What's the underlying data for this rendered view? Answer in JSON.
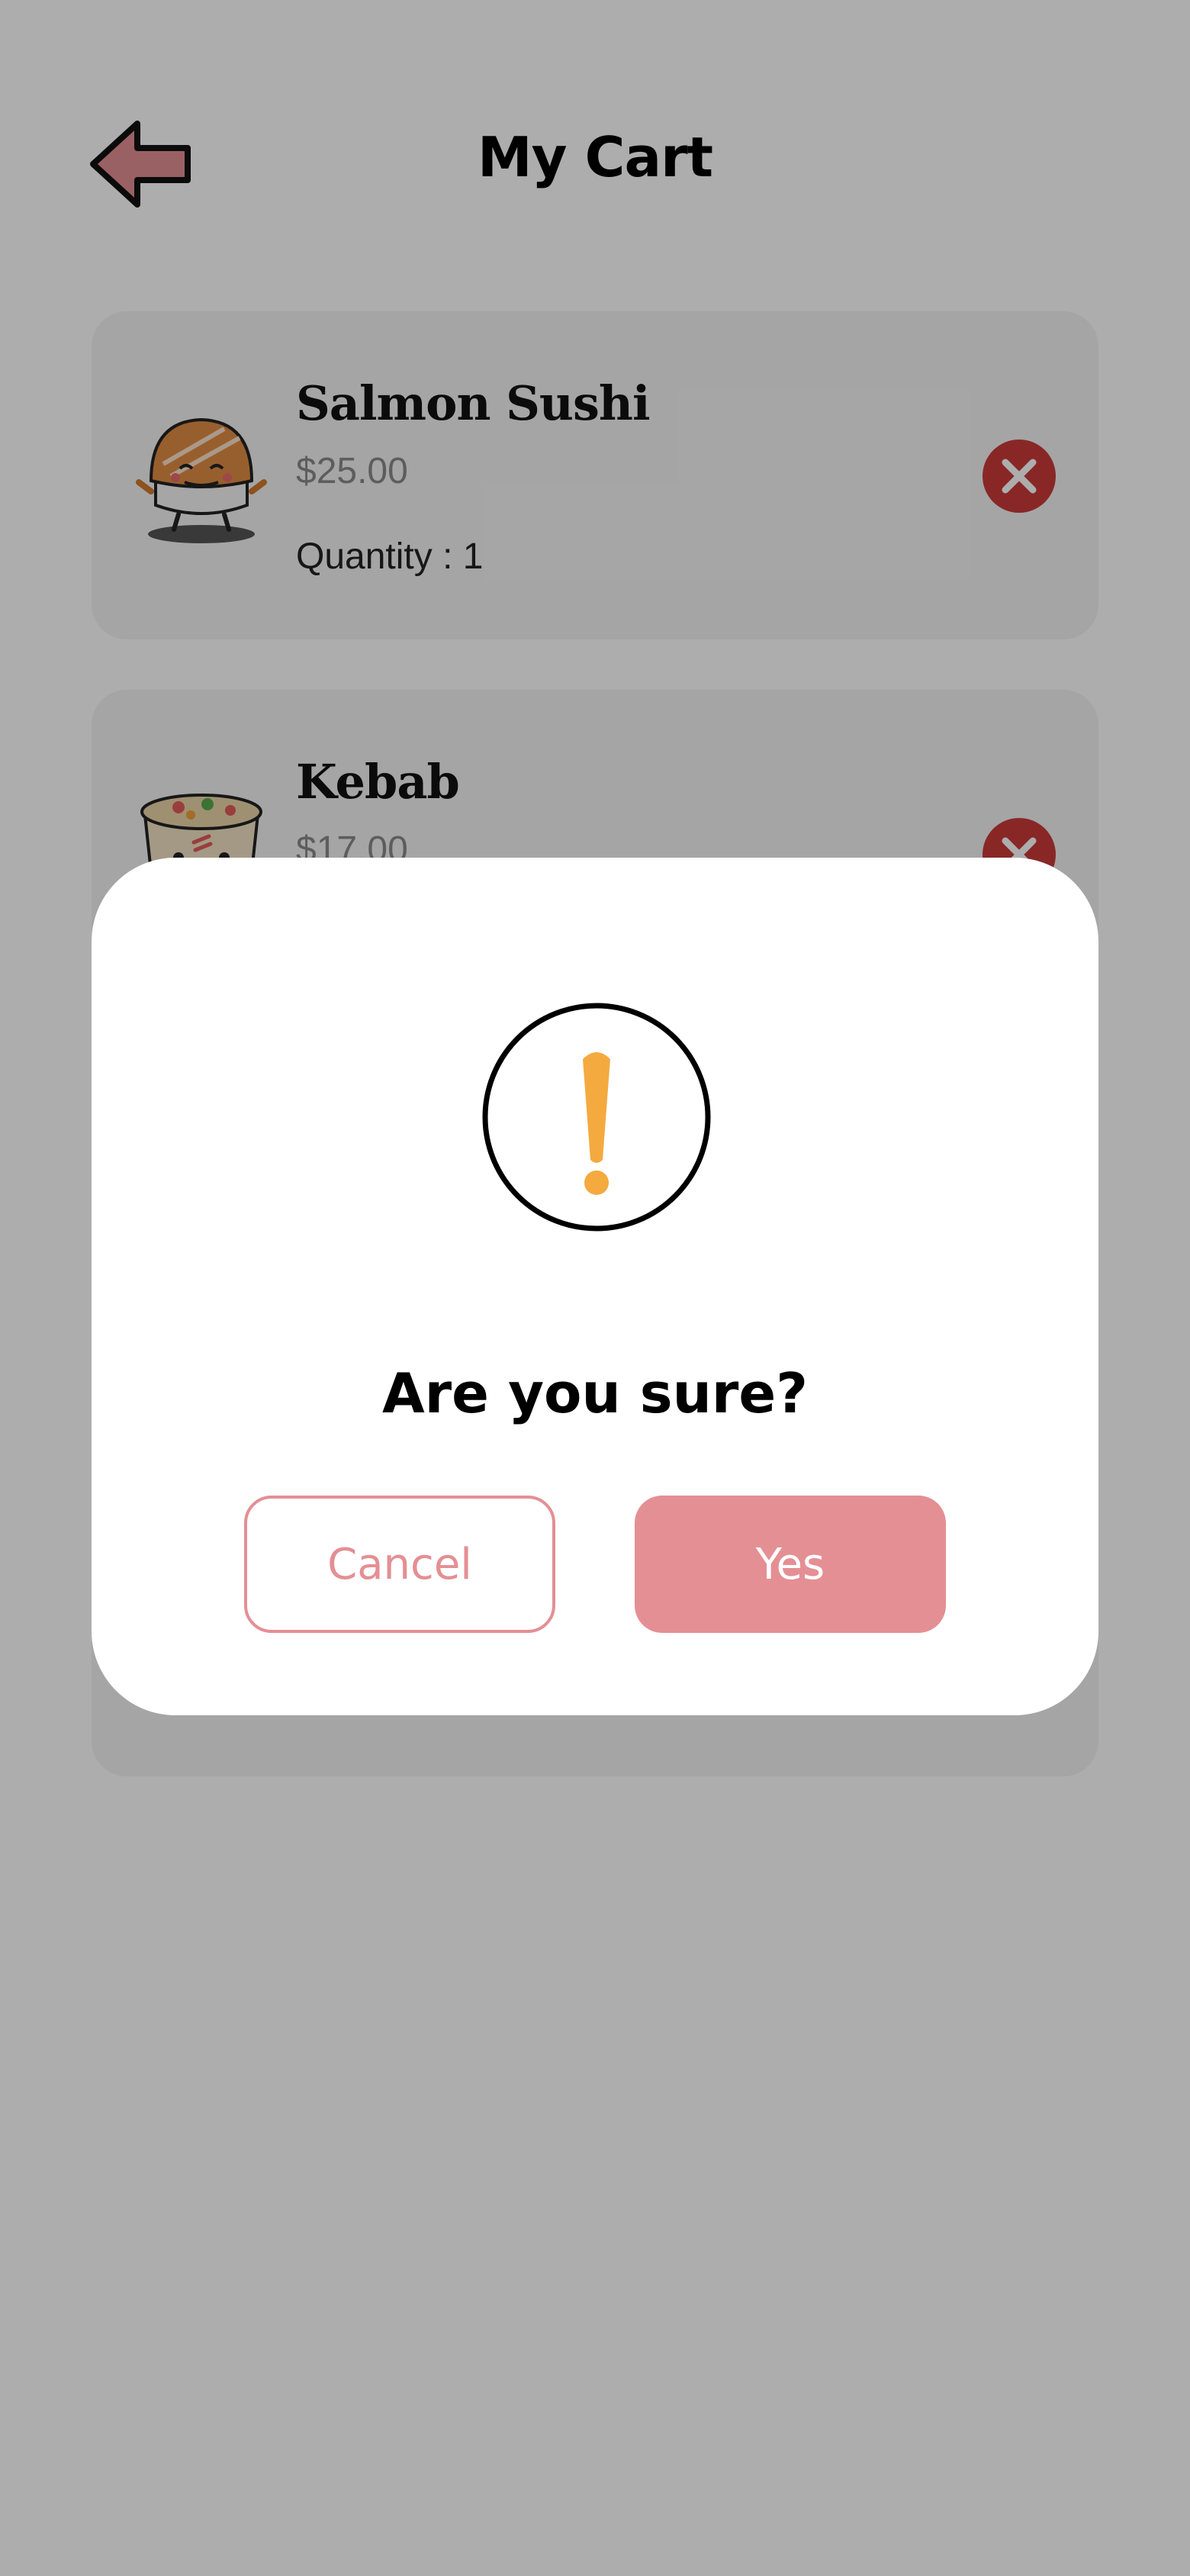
{
  "header": {
    "title": "My Cart",
    "back_icon": "back-arrow-icon"
  },
  "cart": {
    "items": [
      {
        "name": "Salmon Sushi",
        "price": "$25.00",
        "quantity_label": "Quantity : 1",
        "thumb_icon": "salmon-sushi-icon"
      },
      {
        "name": "Kebab",
        "price": "$17.00",
        "quantity_label": "",
        "thumb_icon": "kebab-box-icon"
      }
    ]
  },
  "dialog": {
    "icon": "warning-icon",
    "title": "Are you sure?",
    "cancel_label": "Cancel",
    "yes_label": "Yes"
  },
  "colors": {
    "accent": "#e48f94",
    "warning": "#f4aa3f",
    "remove": "#ca3a3a",
    "back_arrow_fill": "#e48f94",
    "overlay": "rgba(0,0,0,0.32)"
  }
}
